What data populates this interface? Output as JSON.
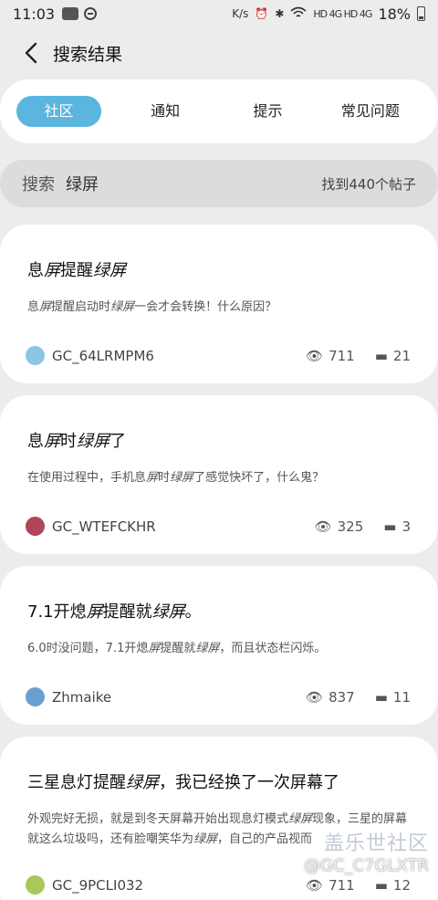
{
  "status_bar": {
    "time": "11:03",
    "network_speed": "K/s",
    "net_icons": "HD 4G HD 4G",
    "battery": "18%"
  },
  "header": {
    "title": "搜索结果"
  },
  "tabs": [
    {
      "label": "社区",
      "active": true
    },
    {
      "label": "通知"
    },
    {
      "label": "提示"
    },
    {
      "label": "常见问题"
    }
  ],
  "search": {
    "label": "搜索",
    "query": "绿屏",
    "result_count": "找到440个帖子"
  },
  "posts": [
    {
      "title": [
        "息",
        "屏",
        "提醒",
        "绿屏",
        ""
      ],
      "snippet": [
        "息",
        "屏",
        "提醒启动时",
        "绿屏",
        "一会才会转换！什么原因？"
      ],
      "author": "GC_64LRMPM6",
      "views": "711",
      "replies": "21",
      "avatar_color": "#8cc4e6"
    },
    {
      "title": [
        "息",
        "屏",
        "时",
        "绿屏",
        "了"
      ],
      "snippet": [
        "在使用过程中，手机息",
        "屏",
        "时",
        "绿屏",
        "了感觉快坏了，什么鬼？"
      ],
      "author": "GC_WTEFCKHR",
      "views": "325",
      "replies": "3",
      "avatar_color": "#b0455a"
    },
    {
      "title": [
        "7.1开熄",
        "屏",
        "提醒就",
        "绿屏",
        "。"
      ],
      "snippet": [
        "6.0时没问题，7.1开熄",
        "屏",
        "提醒就",
        "绿屏",
        "，而且状态栏闪烁。"
      ],
      "author": "Zhmaike",
      "views": "837",
      "replies": "11",
      "avatar_color": "#6aa0d0"
    },
    {
      "title": [
        "三星息灯提醒",
        "绿屏",
        "，我已经换了一次屏幕了",
        "",
        ""
      ],
      "snippet": [
        "外观完好无损，就是到冬天屏幕开始出现息灯模式",
        "绿屏",
        "现象，三星的屏幕就这么垃圾吗，还有脸嘲笑华为",
        "绿屏",
        "，自己的产品视而"
      ],
      "author": "GC_9PCLI032",
      "views": "711",
      "replies": "12",
      "avatar_color": "#a8c85a"
    }
  ],
  "watermark": {
    "logo": "盖乐世社区",
    "user": "@GC_C7GLXTR"
  }
}
